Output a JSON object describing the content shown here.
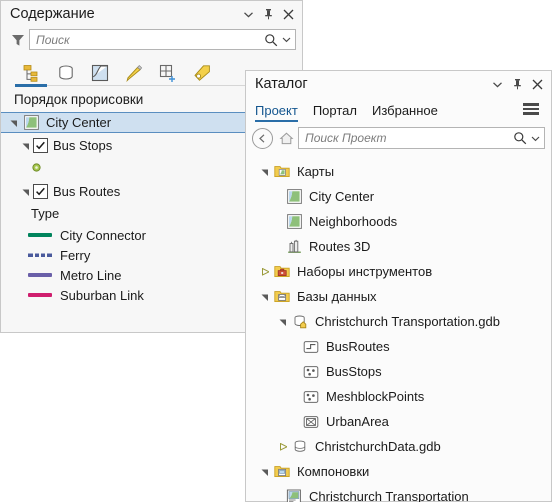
{
  "contents_panel": {
    "title": "Содержание",
    "title_buttons": [
      {
        "name": "chevron-down-icon",
        "label": "⌄"
      },
      {
        "name": "pin-icon",
        "label": "📌"
      },
      {
        "name": "close-icon",
        "label": "✕"
      }
    ],
    "search": {
      "placeholder": "Поиск"
    },
    "toolbar_icons": [
      "list-by-drawing-order-icon",
      "list-by-data-source-icon",
      "list-by-selection-icon",
      "list-by-editing-icon",
      "list-by-snapping-icon",
      "list-by-labeling-icon"
    ],
    "section_title": "Порядок прорисовки",
    "tree": [
      {
        "name": "City Center",
        "icon": "map-icon",
        "selected": true,
        "expanded": true,
        "has_checkbox": false,
        "indent": 0
      },
      {
        "name": "Bus Stops",
        "icon": "checkbox",
        "selected": false,
        "expanded": true,
        "has_checkbox": true,
        "checked": true,
        "indent": 1
      },
      {
        "name": "Bus Routes",
        "icon": "checkbox",
        "selected": false,
        "expanded": true,
        "has_checkbox": true,
        "checked": true,
        "indent": 1
      }
    ],
    "bus_stops_symbol": {
      "name": "point-symbol-green",
      "color": "#9bc24a"
    },
    "bus_routes_legend": {
      "field_label": "Type",
      "items": [
        {
          "label": "City Connector",
          "color": "#00845c",
          "style": "solid"
        },
        {
          "label": "Ferry",
          "color": "#4a5a9c",
          "style": "dashed"
        },
        {
          "label": "Metro Line",
          "color": "#6a5fa8",
          "style": "solid"
        },
        {
          "label": "Suburban Link",
          "color": "#cf1e6e",
          "style": "solid"
        }
      ]
    }
  },
  "catalog_panel": {
    "title": "Каталог",
    "title_buttons": [
      {
        "name": "chevron-down-icon",
        "label": "⌄"
      },
      {
        "name": "pin-icon",
        "label": "📌"
      },
      {
        "name": "close-icon",
        "label": "✕"
      }
    ],
    "tabs": [
      {
        "label": "Проект",
        "active": true
      },
      {
        "label": "Портал",
        "active": false
      },
      {
        "label": "Избранное",
        "active": false
      }
    ],
    "menu_icon": "hamburger-menu-icon",
    "nav": {
      "back_icon": "back-arrow-icon",
      "home_icon": "home-icon",
      "search_placeholder": "Поиск Проект"
    },
    "tree": [
      {
        "label": "Карты",
        "indent": 0,
        "expander": "expanded",
        "icon": "folder-maps-icon"
      },
      {
        "label": "City Center",
        "indent": 1,
        "expander": "none",
        "icon": "map-icon"
      },
      {
        "label": "Neighborhoods",
        "indent": 1,
        "expander": "none",
        "icon": "map-icon"
      },
      {
        "label": "Routes 3D",
        "indent": 1,
        "expander": "none",
        "icon": "scene-3d-icon"
      },
      {
        "label": "Наборы инструментов",
        "indent": 0,
        "expander": "collapsed",
        "icon": "folder-toolbox-icon"
      },
      {
        "label": "Базы данных",
        "indent": 0,
        "expander": "expanded",
        "icon": "folder-database-icon"
      },
      {
        "label": "Christchurch Transportation.gdb",
        "indent": 1,
        "expander": "expanded",
        "icon": "gdb-home-icon"
      },
      {
        "label": "BusRoutes",
        "indent": 2,
        "expander": "none",
        "icon": "polyline-feature-icon"
      },
      {
        "label": "BusStops",
        "indent": 2,
        "expander": "none",
        "icon": "point-feature-icon"
      },
      {
        "label": "MeshblockPoints",
        "indent": 2,
        "expander": "none",
        "icon": "point-feature-icon"
      },
      {
        "label": "UrbanArea",
        "indent": 2,
        "expander": "none",
        "icon": "raster-feature-icon"
      },
      {
        "label": "ChristchurchData.gdb",
        "indent": 1,
        "expander": "collapsed",
        "icon": "gdb-icon"
      },
      {
        "label": "Компоновки",
        "indent": 0,
        "expander": "expanded",
        "icon": "folder-layouts-icon"
      },
      {
        "label": "Christchurch Transportation",
        "indent": 1,
        "expander": "none",
        "icon": "layout-icon"
      }
    ]
  },
  "colors": {
    "accent": "#2a6ea8",
    "selection": "#cfe0f0",
    "panel_bg": "#f7f7f7",
    "border": "#c8c8c8"
  }
}
